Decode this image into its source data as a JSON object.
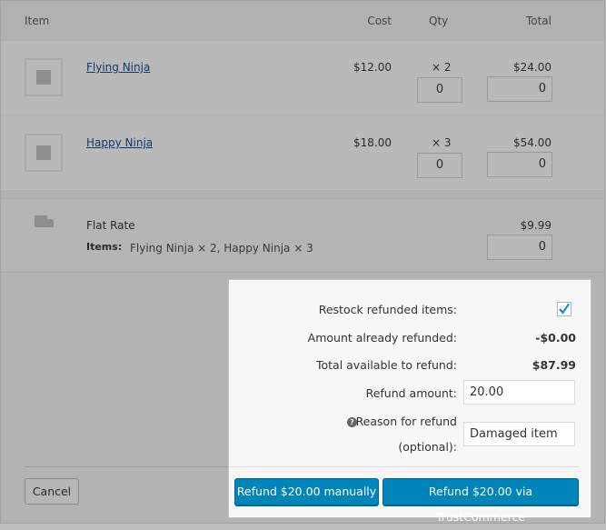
{
  "headers": {
    "item": "Item",
    "cost": "Cost",
    "qty": "Qty",
    "total": "Total"
  },
  "items": [
    {
      "name": "Flying Ninja",
      "cost": "$12.00",
      "qty": "× 2",
      "total": "$24.00",
      "refund_qty": "0",
      "refund_total": "0"
    },
    {
      "name": "Happy Ninja",
      "cost": "$18.00",
      "qty": "× 3",
      "total": "$54.00",
      "refund_qty": "0",
      "refund_total": "0"
    }
  ],
  "shipping": {
    "name": "Flat Rate",
    "items_label": "Items:",
    "items_value": "Flying Ninja × 2, Happy Ninja × 3",
    "total": "$9.99",
    "refund_total": "0"
  },
  "refund": {
    "restock_label": "Restock refunded items:",
    "restock_checked": true,
    "already_label": "Amount already refunded:",
    "already_value": "-$0.00",
    "available_label": "Total available to refund:",
    "available_value": "$87.99",
    "amount_label": "Refund amount:",
    "amount_value": "20.00",
    "reason_label": "Reason for refund",
    "reason_label2": "(optional):",
    "reason_value": "Damaged item",
    "manual_button": "Refund $20.00 manually",
    "gateway_button": "Refund $20.00 via TrustCommerce",
    "cancel_button": "Cancel"
  },
  "colors": {
    "primary": "#0085ba"
  }
}
